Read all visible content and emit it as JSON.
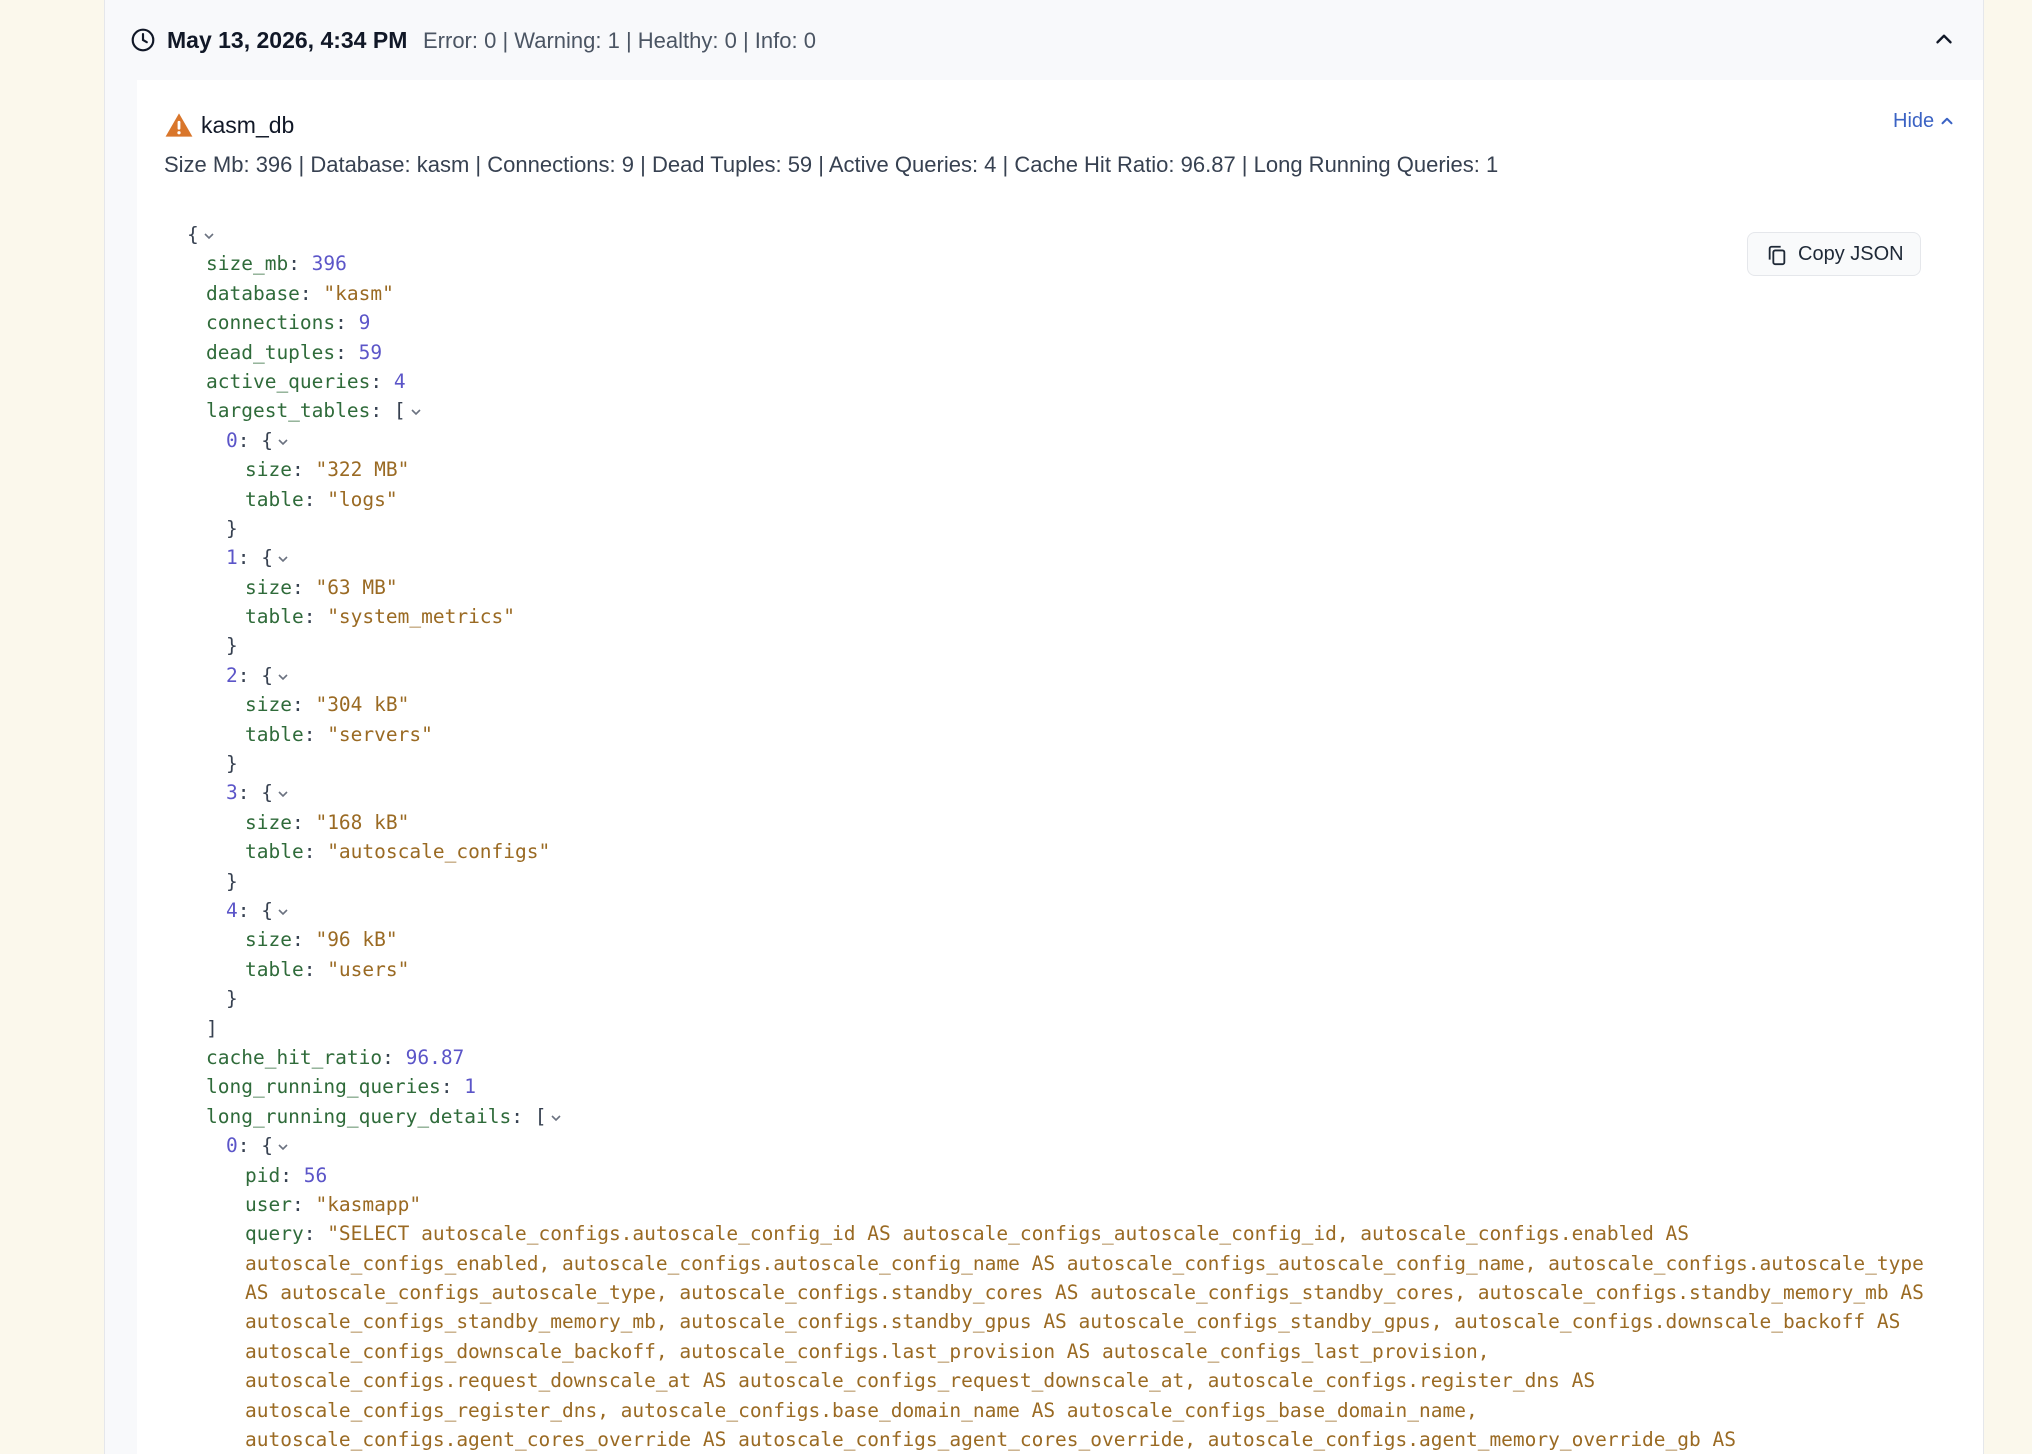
{
  "header": {
    "timestamp": "May 13, 2026, 4:34 PM",
    "status_summary": "Error: 0 | Warning: 1 | Healthy: 0 | Info: 0"
  },
  "check": {
    "name": "kasm_db",
    "status": "warning",
    "hide_label": "Hide",
    "summary": "Size Mb: 396 | Database: kasm | Connections: 9 | Dead Tuples: 59 | Active Queries: 4 | Cache Hit Ratio: 96.87 | Long Running Queries: 1",
    "copy_label": "Copy JSON"
  },
  "json_view": {
    "size_mb": "396",
    "database": "\"kasm\"",
    "connections": "9",
    "dead_tuples": "59",
    "active_queries": "4",
    "largest_tables": [
      {
        "index": "0",
        "size": "\"322 MB\"",
        "table": "\"logs\""
      },
      {
        "index": "1",
        "size": "\"63 MB\"",
        "table": "\"system_metrics\""
      },
      {
        "index": "2",
        "size": "\"304 kB\"",
        "table": "\"servers\""
      },
      {
        "index": "3",
        "size": "\"168 kB\"",
        "table": "\"autoscale_configs\""
      },
      {
        "index": "4",
        "size": "\"96 kB\"",
        "table": "\"users\""
      }
    ],
    "cache_hit_ratio": "96.87",
    "long_running_queries": "1",
    "long_running_query_details": [
      {
        "index": "0",
        "pid": "56",
        "user": "\"kasmapp\"",
        "query_lines": [
          "\"SELECT autoscale_configs.autoscale_config_id AS autoscale_configs_autoscale_config_id, autoscale_configs.enabled AS",
          "autoscale_configs_enabled, autoscale_configs.autoscale_config_name AS autoscale_configs_autoscale_config_name, autoscale_configs.autoscale_type",
          "AS autoscale_configs_autoscale_type, autoscale_configs.standby_cores AS autoscale_configs_standby_cores, autoscale_configs.standby_memory_mb AS",
          "autoscale_configs_standby_memory_mb, autoscale_configs.standby_gpus AS autoscale_configs_standby_gpus, autoscale_configs.downscale_backoff AS",
          "autoscale_configs_downscale_backoff, autoscale_configs.last_provision AS autoscale_configs_last_provision,",
          "autoscale_configs.request_downscale_at AS autoscale_configs_request_downscale_at, autoscale_configs.register_dns AS",
          "autoscale_configs_register_dns, autoscale_configs.base_domain_name AS autoscale_configs_base_domain_name,",
          "autoscale_configs.agent_cores_override AS autoscale_configs_agent_cores_override, autoscale_configs.agent_memory_override_gb AS"
        ]
      }
    ]
  },
  "colors": {
    "page_background": "#fbf8ec",
    "warning": "#d9762b",
    "link": "#3b63c4",
    "json_key": "#2f6b3a",
    "json_number": "#5b55c8",
    "json_string": "#9a6a23"
  },
  "icons": [
    "clock-icon",
    "chevron-up-icon",
    "warning-icon",
    "copy-icon",
    "chevron-down-icon"
  ]
}
